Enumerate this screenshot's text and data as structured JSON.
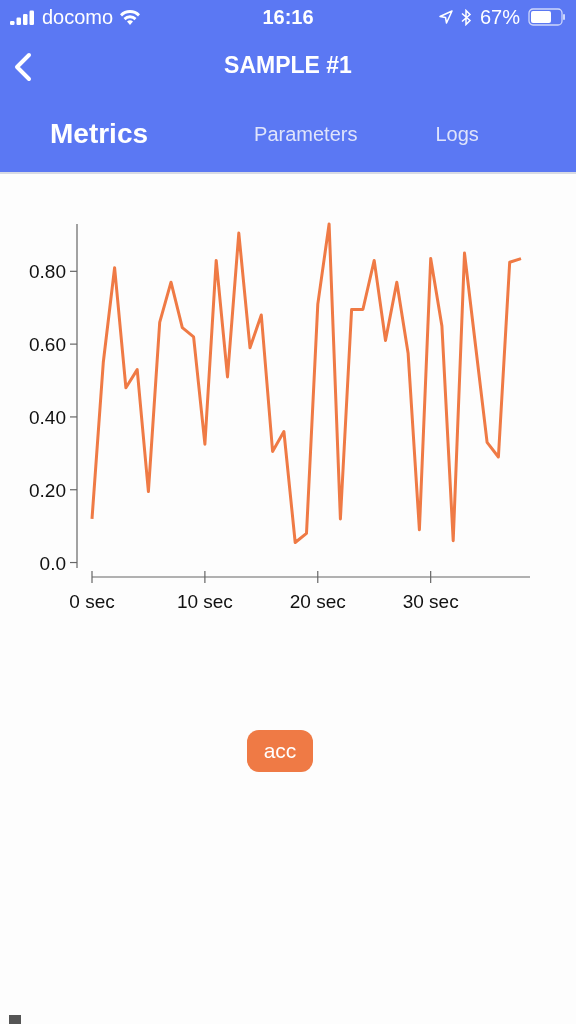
{
  "status_bar": {
    "carrier": "docomo",
    "time": "16:16",
    "battery": "67%"
  },
  "nav": {
    "title": "SAMPLE #1"
  },
  "tabs": [
    {
      "label": "Metrics",
      "selected": true
    },
    {
      "label": "Parameters",
      "selected": false
    },
    {
      "label": "Logs",
      "selected": false
    }
  ],
  "chart": {
    "chart_data": {
      "type": "line",
      "x": [
        0,
        1,
        2,
        3,
        4,
        5,
        6,
        7,
        8,
        9,
        10,
        11,
        12,
        13,
        14,
        15,
        16,
        17,
        18,
        19,
        20,
        21,
        22,
        23,
        24,
        25,
        26,
        27,
        28,
        29,
        30,
        31,
        32,
        33,
        34,
        35,
        36,
        37,
        38
      ],
      "series": [
        {
          "name": "acc",
          "color": "#ef7a45",
          "values": [
            0.12,
            0.55,
            0.81,
            0.48,
            0.53,
            0.195,
            0.66,
            0.77,
            0.645,
            0.62,
            0.325,
            0.83,
            0.51,
            0.905,
            0.59,
            0.68,
            0.305,
            0.36,
            0.055,
            0.08,
            0.71,
            0.93,
            0.12,
            0.695,
            0.695,
            0.83,
            0.61,
            0.77,
            0.575,
            0.09,
            0.835,
            0.65,
            0.06,
            0.85,
            0.59,
            0.33,
            0.29,
            0.825,
            0.835
          ]
        }
      ],
      "xlim": [
        0,
        38.8
      ],
      "ylim": [
        -0.015,
        0.93
      ],
      "xticks": [
        {
          "value": 0,
          "label": "0 sec"
        },
        {
          "value": 10,
          "label": "10 sec"
        },
        {
          "value": 20,
          "label": "20 sec"
        },
        {
          "value": 30,
          "label": "30 sec"
        }
      ],
      "yticks": [
        {
          "value": 0,
          "label": "0.0"
        },
        {
          "value": 0.2,
          "label": "0.20"
        },
        {
          "value": 0.4,
          "label": "0.40"
        },
        {
          "value": 0.6,
          "label": "0.60"
        },
        {
          "value": 0.8,
          "label": "0.80"
        }
      ]
    }
  }
}
